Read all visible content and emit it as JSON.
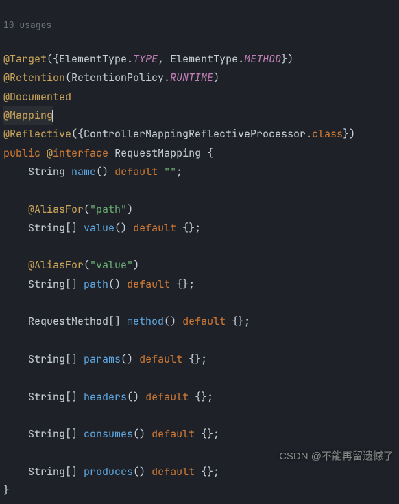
{
  "hint": "10 usages",
  "line1": {
    "ann": "@Target",
    "open": "({",
    "p1a": "ElementType.",
    "p1b": "TYPE",
    "sep": ", ",
    "p2a": "ElementType.",
    "p2b": "METHOD",
    "close": "})"
  },
  "line2": {
    "ann": "@Retention",
    "open": "(",
    "p1a": "RetentionPolicy.",
    "p1b": "RUNTIME",
    "close": ")"
  },
  "line3": {
    "ann": "@Documented"
  },
  "line4": {
    "ann": "@Mapping"
  },
  "line5": {
    "ann": "@Reflective",
    "open": "({",
    "p1": "ControllerMappingReflectiveProcessor.",
    "cls": "class",
    "close": "})"
  },
  "decl": {
    "pub": "public",
    "at": "@",
    "iface": "interface",
    "name": "RequestMapping",
    "open": " {"
  },
  "m_name": {
    "ind": "    ",
    "rt": "String ",
    "name": "name",
    "par": "() ",
    "def": "default",
    "sp": " ",
    "val": "\"\"",
    "end": ";"
  },
  "alias_value": {
    "ind": "    ",
    "ann": "@AliasFor",
    "open": "(",
    "str": "\"path\"",
    "close": ")"
  },
  "m_value": {
    "ind": "    ",
    "rt": "String[] ",
    "name": "value",
    "par": "() ",
    "def": "default",
    "rest": " {};"
  },
  "alias_path": {
    "ind": "    ",
    "ann": "@AliasFor",
    "open": "(",
    "str": "\"value\"",
    "close": ")"
  },
  "m_path": {
    "ind": "    ",
    "rt": "String[] ",
    "name": "path",
    "par": "() ",
    "def": "default",
    "rest": " {};"
  },
  "m_method": {
    "ind": "    ",
    "rt": "RequestMethod[] ",
    "name": "method",
    "par": "() ",
    "def": "default",
    "rest": " {};"
  },
  "m_params": {
    "ind": "    ",
    "rt": "String[] ",
    "name": "params",
    "par": "() ",
    "def": "default",
    "rest": " {};"
  },
  "m_headers": {
    "ind": "    ",
    "rt": "String[] ",
    "name": "headers",
    "par": "() ",
    "def": "default",
    "rest": " {};"
  },
  "m_consumes": {
    "ind": "    ",
    "rt": "String[] ",
    "name": "consumes",
    "par": "() ",
    "def": "default",
    "rest": " {};"
  },
  "m_produces": {
    "ind": "    ",
    "rt": "String[] ",
    "name": "produces",
    "par": "() ",
    "def": "default",
    "rest": " {};"
  },
  "end": {
    "brace": "}"
  },
  "watermark": "CSDN @不能再留遗憾了"
}
